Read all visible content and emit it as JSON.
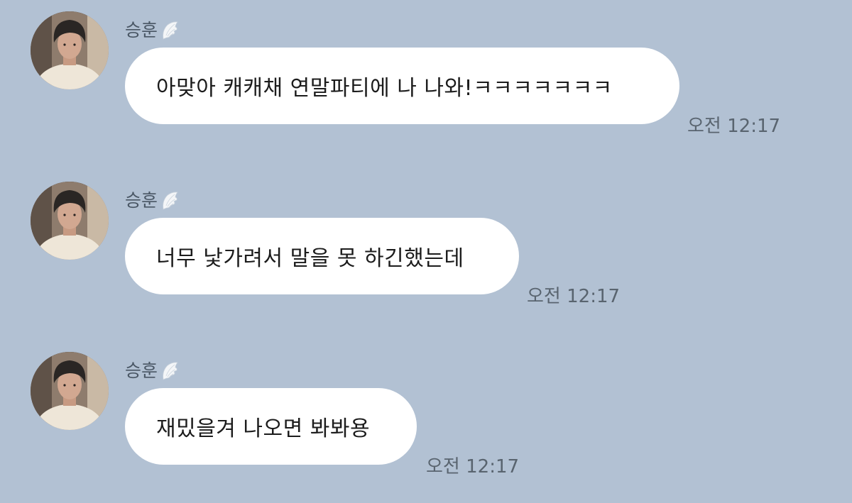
{
  "messages": [
    {
      "sender": "승훈",
      "text": "아맞아 캐캐채 연말파티에 나 나와!ㅋㅋㅋㅋㅋㅋㅋ",
      "time": "오전 12:17"
    },
    {
      "sender": "승훈",
      "text": "너무 낯가려서 말을 못 하긴했는데",
      "time": "오전 12:17"
    },
    {
      "sender": "승훈",
      "text": "재밌을겨 나오면 봐봐용",
      "time": "오전 12:17"
    }
  ],
  "icons": {
    "avatar": "profile-photo",
    "name_badge": "angel-wing-icon"
  },
  "colors": {
    "background": "#b2c1d3",
    "bubble": "#ffffff",
    "sender_text": "#495664",
    "time_text": "#59646f"
  }
}
